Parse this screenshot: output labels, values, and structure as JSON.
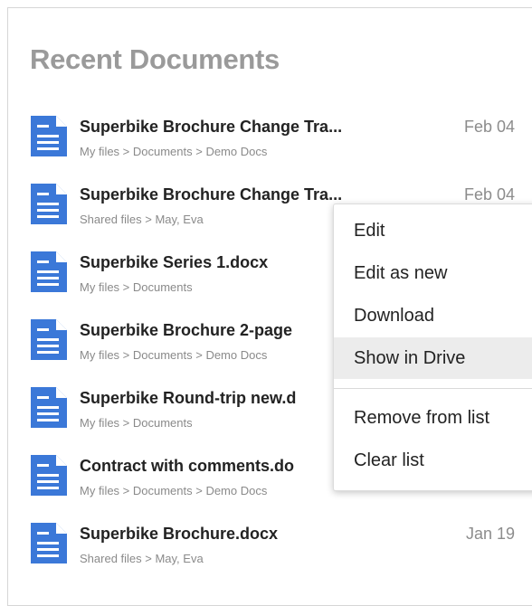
{
  "panel": {
    "title": "Recent Documents"
  },
  "documents": [
    {
      "name": "Superbike Brochure Change Tra...",
      "path": "My files > Documents > Demo Docs",
      "date": "Feb 04",
      "icon": "document-icon"
    },
    {
      "name": "Superbike Brochure Change Tra...",
      "path": "Shared files > May, Eva",
      "date": "Feb 04",
      "icon": "document-icon"
    },
    {
      "name": "Superbike Series 1.docx",
      "path": "My files > Documents",
      "date": "",
      "icon": "document-icon"
    },
    {
      "name": "Superbike Brochure 2-page",
      "path": "My files > Documents > Demo Docs",
      "date": "",
      "icon": "document-icon"
    },
    {
      "name": "Superbike Round-trip new.d",
      "path": "My files > Documents",
      "date": "",
      "icon": "document-icon"
    },
    {
      "name": "Contract with comments.do",
      "path": "My files > Documents > Demo Docs",
      "date": "",
      "icon": "document-icon"
    },
    {
      "name": "Superbike Brochure.docx",
      "path": "Shared files > May, Eva",
      "date": "Jan 19",
      "icon": "document-icon"
    }
  ],
  "context_menu": {
    "items": [
      {
        "label": "Edit"
      },
      {
        "label": "Edit as new"
      },
      {
        "label": "Download"
      },
      {
        "label": "Show in Drive",
        "highlighted": true
      },
      {
        "label": "Remove from list"
      },
      {
        "label": "Clear list"
      }
    ]
  },
  "colors": {
    "icon_blue": "#3b78d8",
    "title_gray": "#9a9a9a",
    "menu_highlight": "#ececec"
  }
}
